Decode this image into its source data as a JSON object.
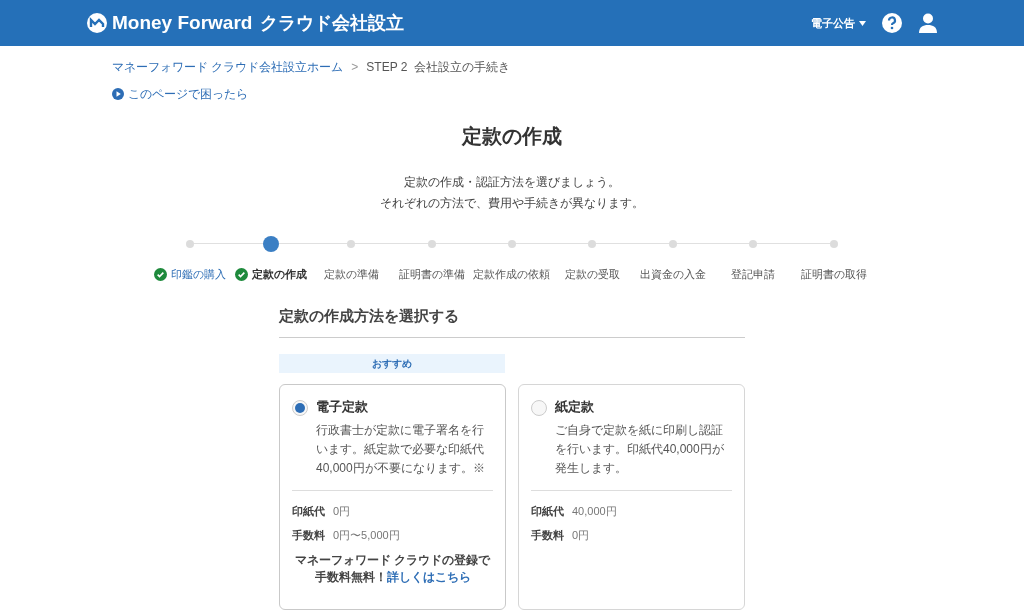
{
  "header": {
    "logo_brand": "Money Forward",
    "logo_product": "クラウド会社設立",
    "menu": "電子公告"
  },
  "breadcrumb_separator": ">",
  "breadcrumb": [
    {
      "label": "マネーフォワード クラウド会社設立ホーム",
      "kind": "link"
    },
    {
      "label": "STEP 2  会社設立の手続き",
      "kind": "current"
    }
  ],
  "help_link": "このページで困ったら",
  "title": "定款の作成",
  "intro": [
    "定款の作成・認証方法を選びましょう。",
    "それぞれの方法で、費用や手続きが異なります。"
  ],
  "steps": [
    {
      "label": "印鑑の購入",
      "kind": "done"
    },
    {
      "label": "定款の作成",
      "kind": "current"
    },
    {
      "label": "定款の準備",
      "kind": "pending"
    },
    {
      "label": "証明書の準備",
      "kind": "pending"
    },
    {
      "label": "定款作成の依頼",
      "kind": "pending"
    },
    {
      "label": "定款の受取",
      "kind": "pending"
    },
    {
      "label": "出資金の入金",
      "kind": "pending"
    },
    {
      "label": "登記申請",
      "kind": "pending"
    },
    {
      "label": "証明書の取得",
      "kind": "pending"
    }
  ],
  "section_title": "定款の作成方法を選択する",
  "recommend_badge": "おすすめ",
  "options": [
    {
      "title": "電子定款",
      "selected": true,
      "description": "行政書士が定款に電子署名を行います。紙定款で必要な印紙代40,000円が不要になります。※",
      "costs": [
        {
          "label": "印紙代",
          "value": "0円"
        },
        {
          "label": "手数料",
          "value": "0円〜5,000円"
        }
      ],
      "note": {
        "line_1": "マネーフォワード クラウドの登録で",
        "line_2": "手数料無料！",
        "link": "詳しくはこちら"
      }
    },
    {
      "title": "紙定款",
      "selected": false,
      "description": "ご自身で定款を紙に印刷し認証を行います。印紙代40,000円が発生します。",
      "costs": [
        {
          "label": "印紙代",
          "value": "40,000円"
        },
        {
          "label": "手数料",
          "value": "0円"
        }
      ]
    }
  ]
}
